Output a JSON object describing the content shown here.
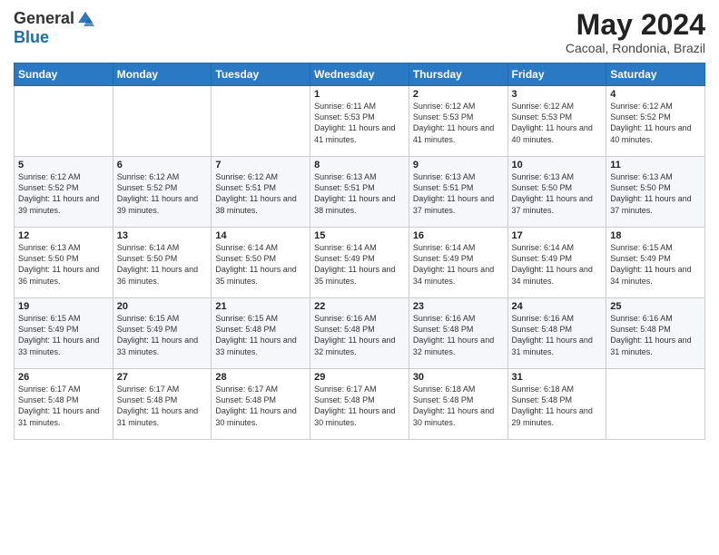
{
  "logo": {
    "general": "General",
    "blue": "Blue"
  },
  "title": {
    "month_year": "May 2024",
    "location": "Cacoal, Rondonia, Brazil"
  },
  "days_of_week": [
    "Sunday",
    "Monday",
    "Tuesday",
    "Wednesday",
    "Thursday",
    "Friday",
    "Saturday"
  ],
  "weeks": [
    [
      {
        "day": "",
        "info": ""
      },
      {
        "day": "",
        "info": ""
      },
      {
        "day": "",
        "info": ""
      },
      {
        "day": "1",
        "info": "Sunrise: 6:11 AM\nSunset: 5:53 PM\nDaylight: 11 hours and 41 minutes."
      },
      {
        "day": "2",
        "info": "Sunrise: 6:12 AM\nSunset: 5:53 PM\nDaylight: 11 hours and 41 minutes."
      },
      {
        "day": "3",
        "info": "Sunrise: 6:12 AM\nSunset: 5:53 PM\nDaylight: 11 hours and 40 minutes."
      },
      {
        "day": "4",
        "info": "Sunrise: 6:12 AM\nSunset: 5:52 PM\nDaylight: 11 hours and 40 minutes."
      }
    ],
    [
      {
        "day": "5",
        "info": "Sunrise: 6:12 AM\nSunset: 5:52 PM\nDaylight: 11 hours and 39 minutes."
      },
      {
        "day": "6",
        "info": "Sunrise: 6:12 AM\nSunset: 5:52 PM\nDaylight: 11 hours and 39 minutes."
      },
      {
        "day": "7",
        "info": "Sunrise: 6:12 AM\nSunset: 5:51 PM\nDaylight: 11 hours and 38 minutes."
      },
      {
        "day": "8",
        "info": "Sunrise: 6:13 AM\nSunset: 5:51 PM\nDaylight: 11 hours and 38 minutes."
      },
      {
        "day": "9",
        "info": "Sunrise: 6:13 AM\nSunset: 5:51 PM\nDaylight: 11 hours and 37 minutes."
      },
      {
        "day": "10",
        "info": "Sunrise: 6:13 AM\nSunset: 5:50 PM\nDaylight: 11 hours and 37 minutes."
      },
      {
        "day": "11",
        "info": "Sunrise: 6:13 AM\nSunset: 5:50 PM\nDaylight: 11 hours and 37 minutes."
      }
    ],
    [
      {
        "day": "12",
        "info": "Sunrise: 6:13 AM\nSunset: 5:50 PM\nDaylight: 11 hours and 36 minutes."
      },
      {
        "day": "13",
        "info": "Sunrise: 6:14 AM\nSunset: 5:50 PM\nDaylight: 11 hours and 36 minutes."
      },
      {
        "day": "14",
        "info": "Sunrise: 6:14 AM\nSunset: 5:50 PM\nDaylight: 11 hours and 35 minutes."
      },
      {
        "day": "15",
        "info": "Sunrise: 6:14 AM\nSunset: 5:49 PM\nDaylight: 11 hours and 35 minutes."
      },
      {
        "day": "16",
        "info": "Sunrise: 6:14 AM\nSunset: 5:49 PM\nDaylight: 11 hours and 34 minutes."
      },
      {
        "day": "17",
        "info": "Sunrise: 6:14 AM\nSunset: 5:49 PM\nDaylight: 11 hours and 34 minutes."
      },
      {
        "day": "18",
        "info": "Sunrise: 6:15 AM\nSunset: 5:49 PM\nDaylight: 11 hours and 34 minutes."
      }
    ],
    [
      {
        "day": "19",
        "info": "Sunrise: 6:15 AM\nSunset: 5:49 PM\nDaylight: 11 hours and 33 minutes."
      },
      {
        "day": "20",
        "info": "Sunrise: 6:15 AM\nSunset: 5:49 PM\nDaylight: 11 hours and 33 minutes."
      },
      {
        "day": "21",
        "info": "Sunrise: 6:15 AM\nSunset: 5:48 PM\nDaylight: 11 hours and 33 minutes."
      },
      {
        "day": "22",
        "info": "Sunrise: 6:16 AM\nSunset: 5:48 PM\nDaylight: 11 hours and 32 minutes."
      },
      {
        "day": "23",
        "info": "Sunrise: 6:16 AM\nSunset: 5:48 PM\nDaylight: 11 hours and 32 minutes."
      },
      {
        "day": "24",
        "info": "Sunrise: 6:16 AM\nSunset: 5:48 PM\nDaylight: 11 hours and 31 minutes."
      },
      {
        "day": "25",
        "info": "Sunrise: 6:16 AM\nSunset: 5:48 PM\nDaylight: 11 hours and 31 minutes."
      }
    ],
    [
      {
        "day": "26",
        "info": "Sunrise: 6:17 AM\nSunset: 5:48 PM\nDaylight: 11 hours and 31 minutes."
      },
      {
        "day": "27",
        "info": "Sunrise: 6:17 AM\nSunset: 5:48 PM\nDaylight: 11 hours and 31 minutes."
      },
      {
        "day": "28",
        "info": "Sunrise: 6:17 AM\nSunset: 5:48 PM\nDaylight: 11 hours and 30 minutes."
      },
      {
        "day": "29",
        "info": "Sunrise: 6:17 AM\nSunset: 5:48 PM\nDaylight: 11 hours and 30 minutes."
      },
      {
        "day": "30",
        "info": "Sunrise: 6:18 AM\nSunset: 5:48 PM\nDaylight: 11 hours and 30 minutes."
      },
      {
        "day": "31",
        "info": "Sunrise: 6:18 AM\nSunset: 5:48 PM\nDaylight: 11 hours and 29 minutes."
      },
      {
        "day": "",
        "info": ""
      }
    ]
  ]
}
